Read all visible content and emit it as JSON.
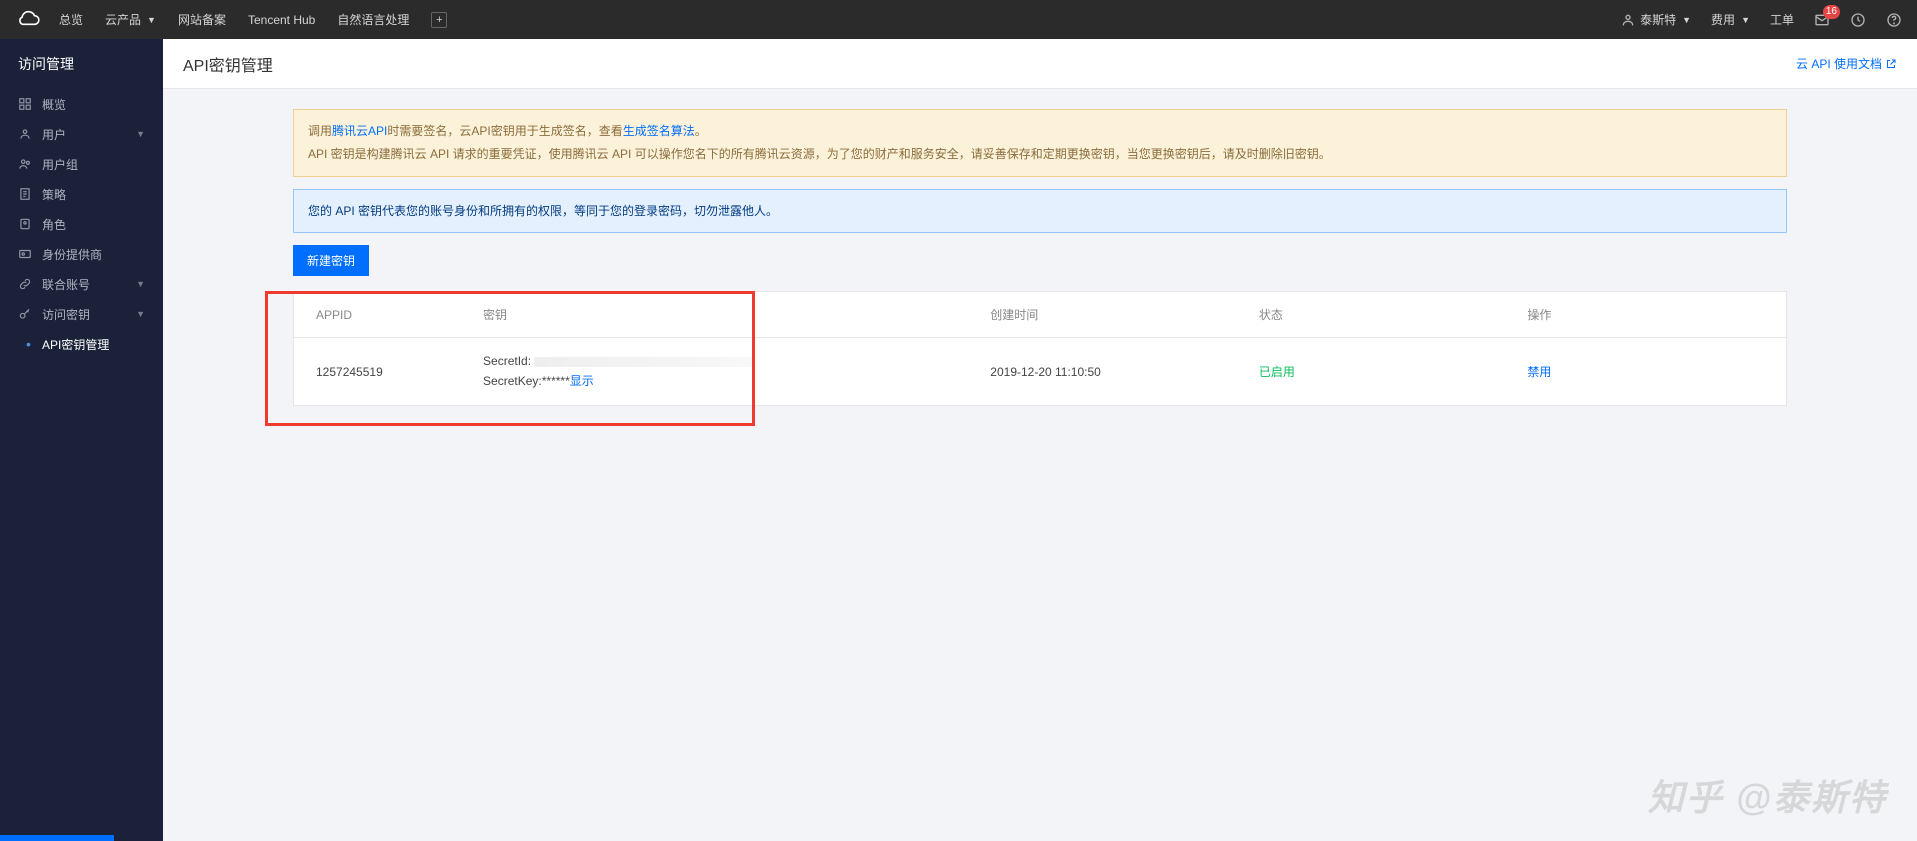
{
  "header": {
    "nav": {
      "overview": "总览",
      "products": "云产品",
      "beian": "网站备案",
      "hub": "Tencent Hub",
      "nlp": "自然语言处理"
    },
    "right": {
      "username": "泰斯特",
      "fees": "费用",
      "workorder": "工单",
      "msg_badge": "16"
    }
  },
  "sidebar": {
    "title": "访问管理",
    "overview": "概览",
    "users": "用户",
    "usergroup": "用户组",
    "policy": "策略",
    "role": "角色",
    "idp": "身份提供商",
    "federated": "联合账号",
    "access_key": "访问密钥",
    "api_key": "API密钥管理"
  },
  "page": {
    "title": "API密钥管理",
    "doc_link": "云 API 使用文档"
  },
  "alerts": {
    "warn_pre": "调用",
    "warn_link1": "腾讯云API",
    "warn_mid": "时需要签名，云API密钥用于生成签名，查看",
    "warn_link2": "生成签名算法",
    "warn_end": "。",
    "warn_line2": "API 密钥是构建腾讯云 API 请求的重要凭证，使用腾讯云 API 可以操作您名下的所有腾讯云资源，为了您的财产和服务安全，请妥善保存和定期更换密钥，当您更换密钥后，请及时删除旧密钥。",
    "info": "您的 API 密钥代表您的账号身份和所拥有的权限，等同于您的登录密码，切勿泄露他人。"
  },
  "buttons": {
    "new_key": "新建密钥"
  },
  "table": {
    "headers": {
      "appid": "APPID",
      "key": "密钥",
      "created": "创建时间",
      "status": "状态",
      "action": "操作"
    },
    "row": {
      "appid": "1257245519",
      "secret_id_label": "SecretId:",
      "secret_key_label": "SecretKey:",
      "secret_key_masked": "******",
      "show": "显示",
      "created": "2019-12-20 11:10:50",
      "status": "已启用",
      "action": "禁用"
    }
  },
  "watermark": "知乎 @泰斯特"
}
